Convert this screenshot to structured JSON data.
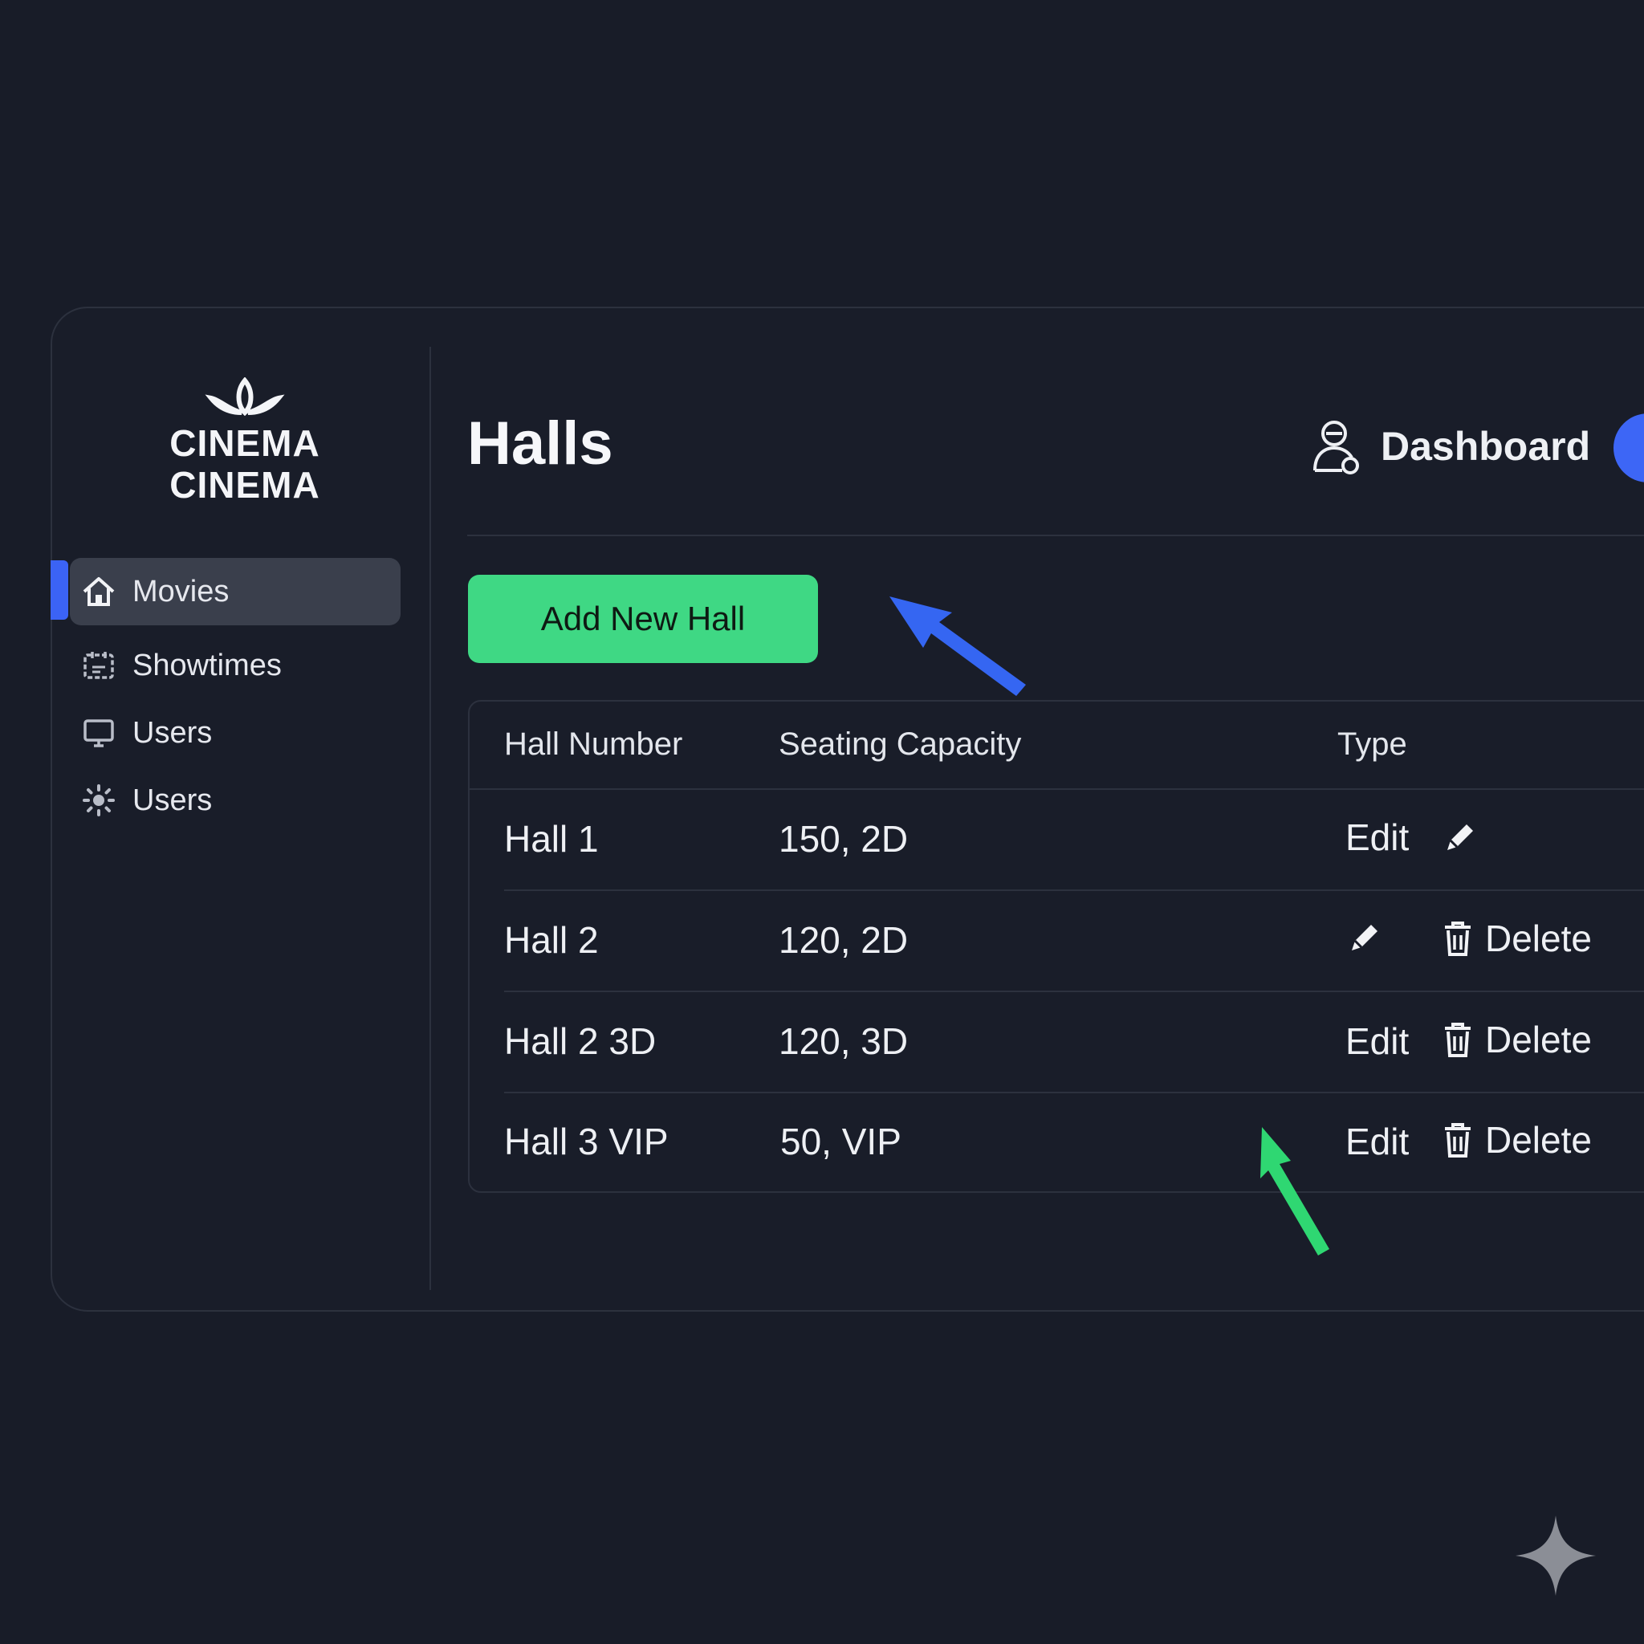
{
  "brand": {
    "line1": "CINEMA",
    "line2": "CINEMA"
  },
  "sidebar": {
    "items": [
      {
        "label": "Movies",
        "icon": "home-icon",
        "active": true
      },
      {
        "label": "Showtimes",
        "icon": "calendar-icon",
        "active": false
      },
      {
        "label": "Users",
        "icon": "monitor-icon",
        "active": false
      },
      {
        "label": "Users",
        "icon": "settings-icon",
        "active": false
      }
    ]
  },
  "header": {
    "title": "Halls",
    "dashboard_label": "Dashboard"
  },
  "toolbar": {
    "add_label": "Add New Hall"
  },
  "table": {
    "headers": [
      "Hall Number",
      "Seating Capacity",
      "Type"
    ],
    "rows": [
      {
        "hall": "Hall 1",
        "capacity": "150, 2D",
        "edit_label": "Edit",
        "delete_label": ""
      },
      {
        "hall": "Hall 2",
        "capacity": "120, 2D",
        "edit_label": "",
        "delete_label": "Delete"
      },
      {
        "hall": "Hall 2 3D",
        "capacity": "120, 3D",
        "edit_label": "Edit",
        "delete_label": "Delete"
      },
      {
        "hall": "Hall 3 VIP",
        "capacity": "50, VIP",
        "edit_label": "Edit",
        "delete_label": "Delete"
      }
    ]
  },
  "colors": {
    "background": "#181c28",
    "accent_blue": "#3b63f5",
    "accent_green": "#3fd884",
    "active_nav": "#3a3f4c"
  }
}
